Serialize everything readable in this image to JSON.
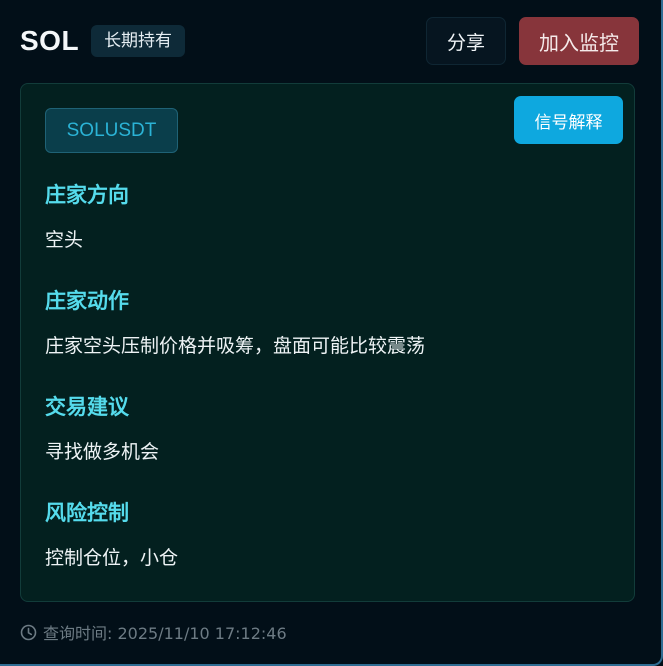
{
  "header": {
    "symbol": "SOL",
    "badge": "长期持有",
    "share_label": "分享",
    "monitor_label": "加入监控"
  },
  "card": {
    "pair": "SOLUSDT",
    "explain_label": "信号解释",
    "sections": [
      {
        "title": "庄家方向",
        "value": "空头"
      },
      {
        "title": "庄家动作",
        "value": "庄家空头压制价格并吸筹，盘面可能比较震荡"
      },
      {
        "title": "交易建议",
        "value": "寻找做多机会"
      },
      {
        "title": "风险控制",
        "value": "控制仓位，小仓"
      }
    ]
  },
  "footer": {
    "query_time": "查询时间: 2025/11/10 17:12:46",
    "icon": "clock-icon"
  },
  "colors": {
    "background": "#020f18",
    "card": "#03201f",
    "accent_title": "#55dbec",
    "explain_button": "#0ea8df",
    "monitor_button": "#87353b"
  }
}
